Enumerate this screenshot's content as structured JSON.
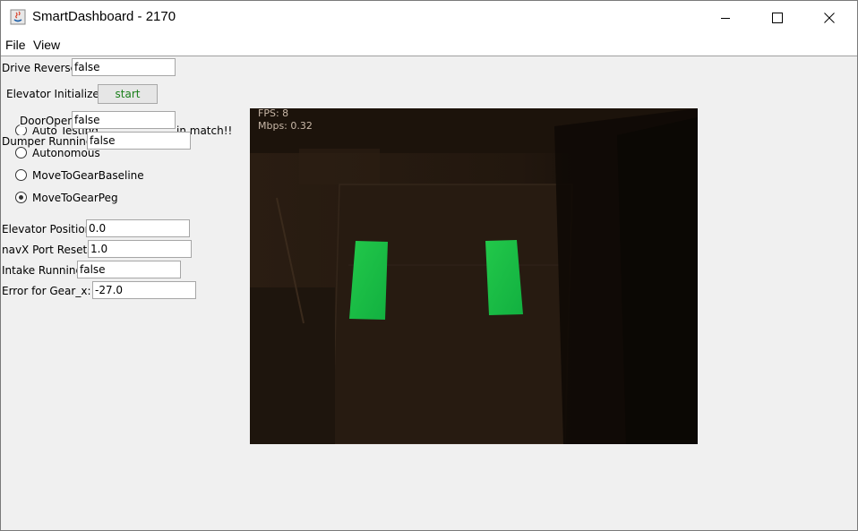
{
  "window": {
    "title": "SmartDashboard - 2170",
    "controls": [
      "minimize",
      "maximize",
      "close"
    ]
  },
  "menu": {
    "items": [
      "File",
      "View"
    ]
  },
  "widgets": {
    "drive_reverse": {
      "label": "Drive Reverse",
      "value": "false"
    },
    "elevator_initialize": {
      "label": "Elevator Initialize",
      "button": "start"
    },
    "door_open": {
      "label": "DoorOpen",
      "value": "false"
    },
    "auto_mode": {
      "label_visible": "Auto Testing",
      "label_tail": "in match!!",
      "options": [
        {
          "label": "Autonomous",
          "selected": false
        },
        {
          "label": "MoveToGearBaseline",
          "selected": false
        },
        {
          "label": "MoveToGearPeg",
          "selected": true
        }
      ]
    },
    "dumper_running": {
      "label": "Dumper Running",
      "value": "false"
    },
    "elevator_position": {
      "label": "Elevator Position",
      "value": "0.0"
    },
    "navx_port_resets": {
      "label": "navX Port Resets",
      "value": "1.0"
    },
    "intake_running": {
      "label": "Intake Running",
      "value": "false"
    },
    "error_gear_x": {
      "label": "Error for Gear_x:",
      "value": "-27.0"
    }
  },
  "camera": {
    "fps": "FPS: 8",
    "mbps": "Mbps: 0.32",
    "target_color": "#1fcf4a",
    "background_color": "#1a120a"
  },
  "colors": {
    "start_button_text": "#1a7f1a"
  }
}
